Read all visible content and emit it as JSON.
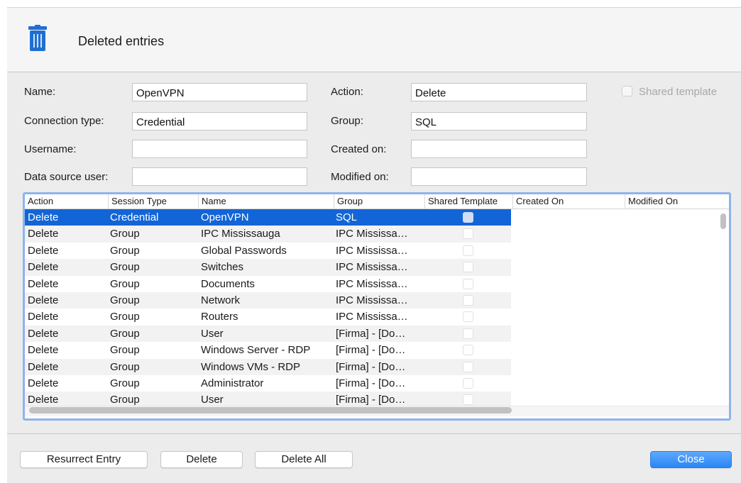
{
  "header": {
    "title": "Deleted entries",
    "icon": "trash-icon"
  },
  "form": {
    "name": {
      "label": "Name:",
      "value": "OpenVPN"
    },
    "connection_type": {
      "label": "Connection type:",
      "value": "Credential"
    },
    "username": {
      "label": "Username:",
      "value": ""
    },
    "data_source_user": {
      "label": "Data source user:",
      "value": ""
    },
    "action": {
      "label": "Action:",
      "value": "Delete"
    },
    "group": {
      "label": "Group:",
      "value": "SQL"
    },
    "created_on": {
      "label": "Created on:",
      "value": ""
    },
    "modified_on": {
      "label": "Modified on:",
      "value": ""
    },
    "shared_template": {
      "label": "Shared template",
      "checked": false,
      "enabled": false
    }
  },
  "table": {
    "columns": [
      "Action",
      "Session Type",
      "Name",
      "Group",
      "Shared Template",
      "Created On",
      "Modified On"
    ],
    "rows": [
      {
        "action": "Delete",
        "session_type": "Credential",
        "name": "OpenVPN",
        "group": "SQL",
        "selected": true
      },
      {
        "action": "Delete",
        "session_type": "Group",
        "name": "IPC Mississauga",
        "group": "IPC Mississa…"
      },
      {
        "action": "Delete",
        "session_type": "Group",
        "name": "Global Passwords",
        "group": "IPC Mississa…"
      },
      {
        "action": "Delete",
        "session_type": "Group",
        "name": "Switches",
        "group": "IPC Mississa…"
      },
      {
        "action": "Delete",
        "session_type": "Group",
        "name": "Documents",
        "group": "IPC Mississa…"
      },
      {
        "action": "Delete",
        "session_type": "Group",
        "name": "Network",
        "group": "IPC Mississa…"
      },
      {
        "action": "Delete",
        "session_type": "Group",
        "name": "Routers",
        "group": "IPC Mississa…"
      },
      {
        "action": "Delete",
        "session_type": "Group",
        "name": "User",
        "group": "[Firma] - [Do…"
      },
      {
        "action": "Delete",
        "session_type": "Group",
        "name": "Windows Server - RDP",
        "group": "[Firma] - [Do…"
      },
      {
        "action": "Delete",
        "session_type": "Group",
        "name": "Windows VMs - RDP",
        "group": "[Firma] - [Do…"
      },
      {
        "action": "Delete",
        "session_type": "Group",
        "name": "Administrator",
        "group": "[Firma] - [Do…"
      },
      {
        "action": "Delete",
        "session_type": "Group",
        "name": "User",
        "group": "[Firma] - [Do…"
      }
    ]
  },
  "buttons": {
    "resurrect": "Resurrect Entry",
    "delete": "Delete",
    "delete_all": "Delete All",
    "close": "Close"
  },
  "colors": {
    "selection": "#1265d6",
    "accent_button": "#2a86f6",
    "focus_ring": "#8db4ec"
  }
}
